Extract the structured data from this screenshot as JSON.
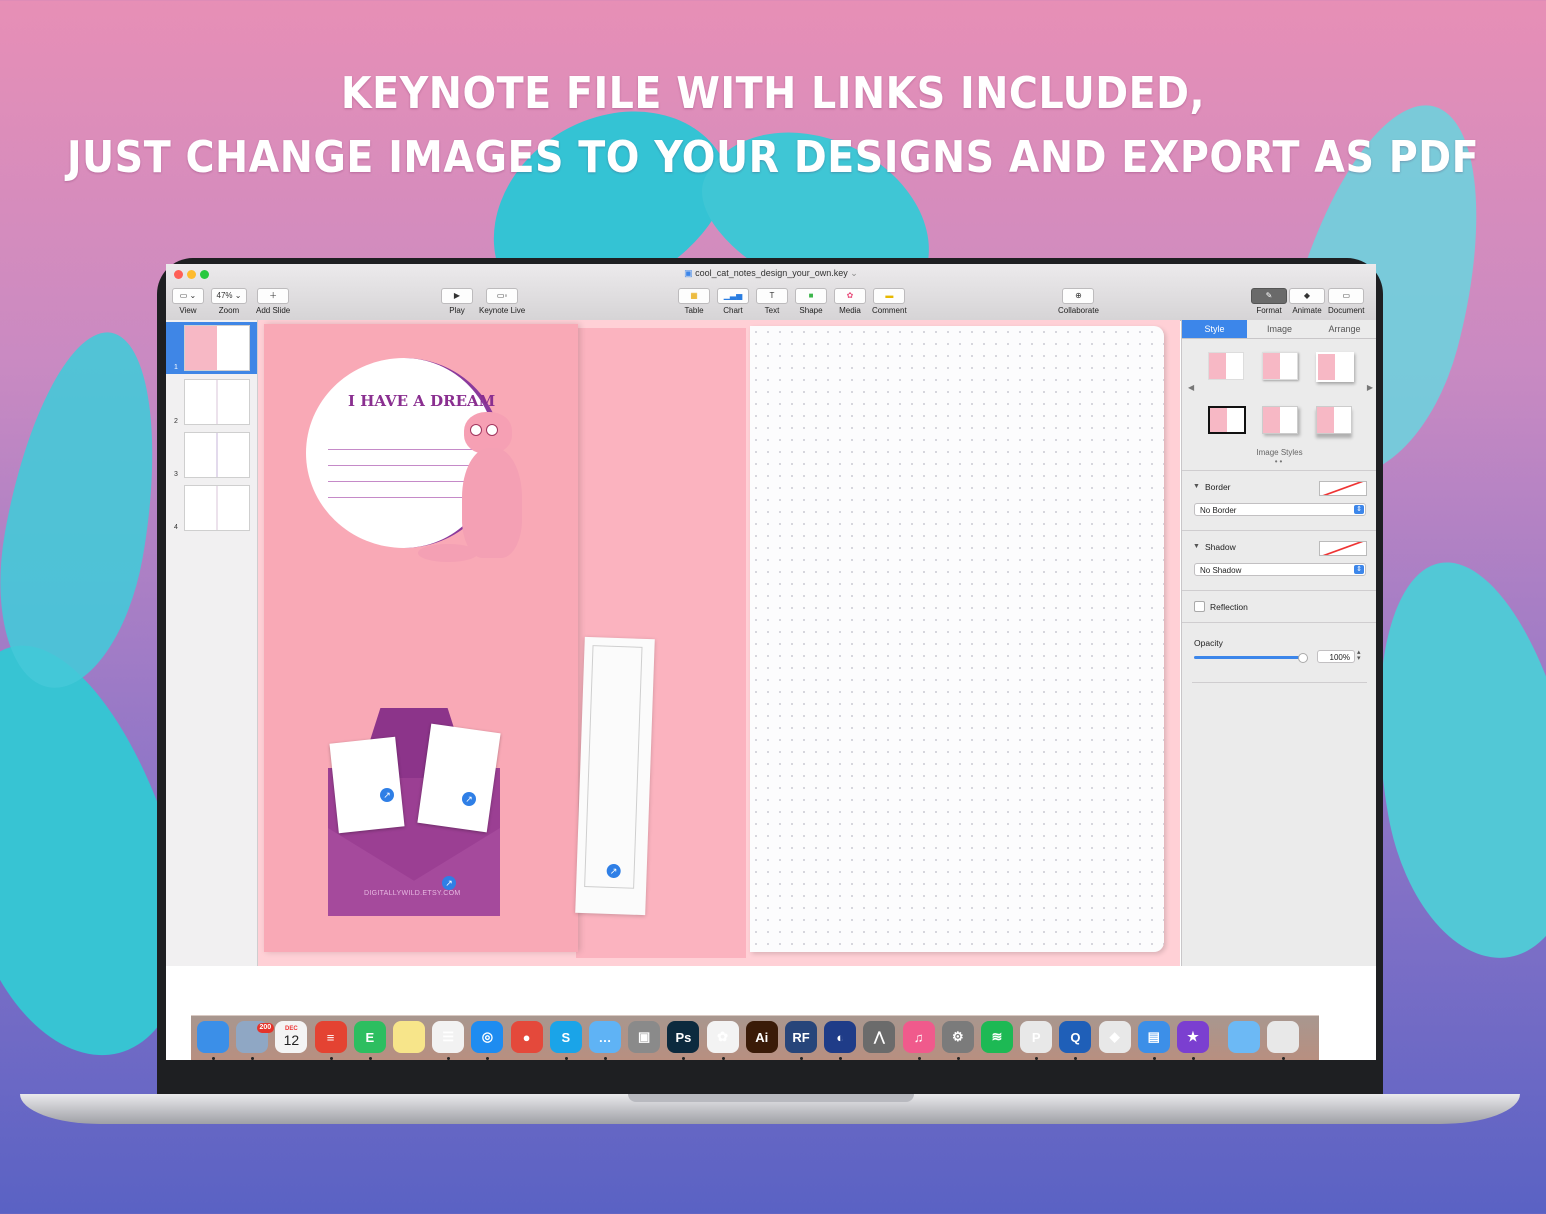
{
  "headline": {
    "line1": "KEYNOTE FILE WITH LINKS INCLUDED,",
    "line2": "JUST CHANGE IMAGES TO YOUR DESIGNS AND EXPORT AS PDF"
  },
  "window": {
    "title": "cool_cat_notes_design_your_own.key",
    "zoom_value": "47%",
    "toolbar_left": [
      {
        "label": "View",
        "icon": "sidebar-view-icon"
      },
      {
        "label": "Zoom",
        "icon": "zoom-icon"
      },
      {
        "label": "Add Slide",
        "icon": "plus-icon"
      }
    ],
    "toolbar_play": [
      {
        "label": "Play",
        "icon": "play-icon"
      },
      {
        "label": "Keynote Live",
        "icon": "keynote-live-icon"
      }
    ],
    "toolbar_insert": [
      {
        "label": "Table",
        "icon": "table-icon"
      },
      {
        "label": "Chart",
        "icon": "chart-icon"
      },
      {
        "label": "Text",
        "icon": "text-icon"
      },
      {
        "label": "Shape",
        "icon": "shape-icon"
      },
      {
        "label": "Media",
        "icon": "media-icon"
      },
      {
        "label": "Comment",
        "icon": "comment-icon"
      }
    ],
    "toolbar_collab": {
      "label": "Collaborate",
      "icon": "collaborate-icon"
    },
    "toolbar_right": [
      {
        "label": "Format",
        "icon": "format-brush-icon"
      },
      {
        "label": "Animate",
        "icon": "animate-diamond-icon"
      },
      {
        "label": "Document",
        "icon": "document-icon"
      }
    ]
  },
  "slides": [
    {
      "number": "1"
    },
    {
      "number": "2"
    },
    {
      "number": "3"
    },
    {
      "number": "4"
    }
  ],
  "slide_content": {
    "dream_title": "I HAVE A DREAM",
    "watermark": "DIGITALLYWILD.ETSY.COM"
  },
  "inspector": {
    "tabs": [
      "Style",
      "Image",
      "Arrange"
    ],
    "image_styles_label": "Image Styles",
    "border_label": "Border",
    "border_value": "No Border",
    "shadow_label": "Shadow",
    "shadow_value": "No Shadow",
    "reflection_label": "Reflection",
    "opacity_label": "Opacity",
    "opacity_value": "100%"
  },
  "dock": {
    "mail_badge": "200",
    "calendar_month": "DEC",
    "calendar_day": "12",
    "apps": [
      {
        "name": "finder-icon",
        "glyph": "",
        "color": "#3b8fe8"
      },
      {
        "name": "mail-icon",
        "glyph": "",
        "color": "#8fa7c4"
      },
      {
        "name": "calendar-icon",
        "glyph": "",
        "color": "#f4f4f4"
      },
      {
        "name": "todoist-icon",
        "glyph": "≡",
        "color": "#e44332"
      },
      {
        "name": "evernote-icon",
        "glyph": "E",
        "color": "#2dbe60"
      },
      {
        "name": "notes-icon",
        "glyph": "",
        "color": "#f7e58a"
      },
      {
        "name": "reminders-icon",
        "glyph": "☰",
        "color": "#f2f2f2"
      },
      {
        "name": "safari-icon",
        "glyph": "◎",
        "color": "#1e8cf0"
      },
      {
        "name": "chrome-icon",
        "glyph": "●",
        "color": "#e4493b"
      },
      {
        "name": "skype-icon",
        "glyph": "S",
        "color": "#1aa4e8"
      },
      {
        "name": "messages-icon",
        "glyph": "…",
        "color": "#5fb3f5"
      },
      {
        "name": "screenshot-icon",
        "glyph": "▣",
        "color": "#8a8a8a"
      },
      {
        "name": "photoshop-icon",
        "glyph": "Ps",
        "color": "#0c2a3e"
      },
      {
        "name": "photos-icon",
        "glyph": "✿",
        "color": "#f3f3f3"
      },
      {
        "name": "illustrator-icon",
        "glyph": "Ai",
        "color": "#3a1b08"
      },
      {
        "name": "rf-icon",
        "glyph": "RF",
        "color": "#27457a"
      },
      {
        "name": "cinema4d-icon",
        "glyph": "◐",
        "color": "#1f3c88"
      },
      {
        "name": "zbrush-icon",
        "glyph": "⋀",
        "color": "#6b6b6b"
      },
      {
        "name": "itunes-icon",
        "glyph": "♫",
        "color": "#f05a8c"
      },
      {
        "name": "system-preferences-icon",
        "glyph": "⚙",
        "color": "#7b7b7b"
      },
      {
        "name": "spotify-icon",
        "glyph": "≋",
        "color": "#1db954"
      },
      {
        "name": "pixelmator-icon",
        "glyph": "P",
        "color": "#e8e8e8"
      },
      {
        "name": "quicktime-icon",
        "glyph": "Q",
        "color": "#1f5fb8"
      },
      {
        "name": "scrivener-icon",
        "glyph": "◆",
        "color": "#e8e8e8"
      },
      {
        "name": "keynote-icon",
        "glyph": "▤",
        "color": "#3c8fe8"
      },
      {
        "name": "imovie-icon",
        "glyph": "★",
        "color": "#7b3fd0"
      },
      {
        "name": "downloads-folder-icon",
        "glyph": "",
        "color": "#6cb9f5"
      },
      {
        "name": "trash-icon",
        "glyph": "",
        "color": "#e8e8e8"
      }
    ]
  }
}
